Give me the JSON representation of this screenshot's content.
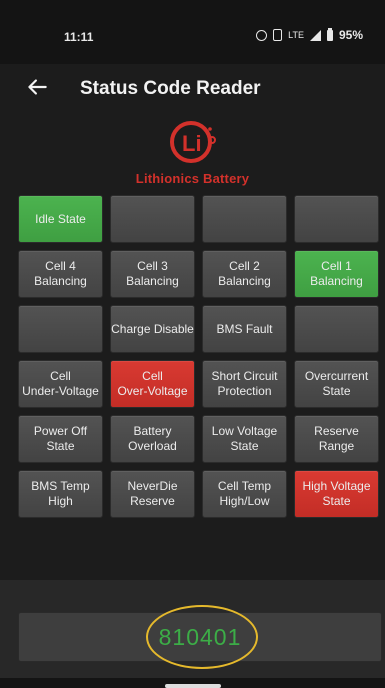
{
  "status_bar": {
    "time": "11:11",
    "icons": [
      "alarm-icon",
      "vibrate-icon",
      "signal-icon",
      "battery-icon"
    ],
    "network": "LTE",
    "battery": "95%"
  },
  "app_bar": {
    "back_icon": "arrow-left-icon",
    "title": "Status Code Reader"
  },
  "logo": {
    "mark": "Li",
    "text": "Lithionics Battery",
    "color": "#d3312b"
  },
  "colors": {
    "green": "#45aa48",
    "red": "#cf332c",
    "gray": "#4b4b4b",
    "code": "#3cad47",
    "highlight": "#e5b92c"
  },
  "grid": {
    "rows": [
      [
        {
          "label": "Idle State",
          "state": "green"
        },
        {
          "label": "",
          "state": "gray"
        },
        {
          "label": "",
          "state": "gray"
        },
        {
          "label": "",
          "state": "gray"
        }
      ],
      [
        {
          "label": "Cell 4\nBalancing",
          "state": "gray"
        },
        {
          "label": "Cell 3\nBalancing",
          "state": "gray"
        },
        {
          "label": "Cell 2\nBalancing",
          "state": "gray"
        },
        {
          "label": "Cell 1\nBalancing",
          "state": "green"
        }
      ],
      [
        {
          "label": "",
          "state": "gray"
        },
        {
          "label": "Charge Disable",
          "state": "gray"
        },
        {
          "label": "BMS Fault",
          "state": "gray"
        },
        {
          "label": "",
          "state": "gray"
        }
      ],
      [
        {
          "label": "Cell\nUnder-Voltage",
          "state": "gray"
        },
        {
          "label": "Cell\nOver-Voltage",
          "state": "red"
        },
        {
          "label": "Short Circuit\nProtection",
          "state": "gray"
        },
        {
          "label": "Overcurrent\nState",
          "state": "gray"
        }
      ],
      [
        {
          "label": "Power Off\nState",
          "state": "gray"
        },
        {
          "label": "Battery\nOverload",
          "state": "gray"
        },
        {
          "label": "Low Voltage\nState",
          "state": "gray"
        },
        {
          "label": "Reserve Range",
          "state": "gray"
        }
      ],
      [
        {
          "label": "BMS Temp\nHigh",
          "state": "gray"
        },
        {
          "label": "NeverDie\nReserve",
          "state": "gray"
        },
        {
          "label": "Cell Temp\nHigh/Low",
          "state": "gray"
        },
        {
          "label": "High Voltage\nState",
          "state": "red"
        }
      ]
    ]
  },
  "code": {
    "value": "810401"
  }
}
